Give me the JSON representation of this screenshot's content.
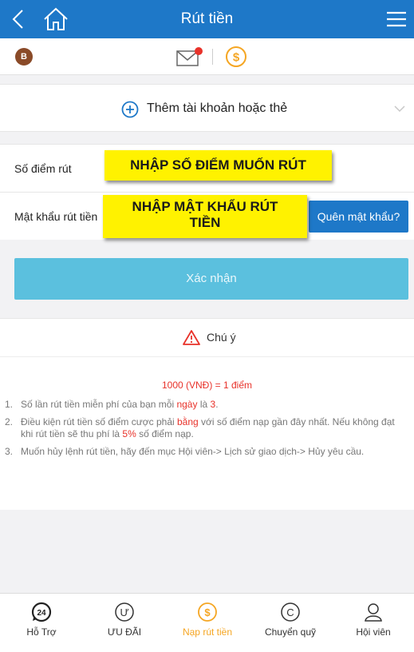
{
  "header": {
    "title": "Rút tiền"
  },
  "user": {
    "avatar_letter": "B"
  },
  "add_account": {
    "label": "Thêm tài khoản hoặc thẻ"
  },
  "form": {
    "points_label": "Số điểm rút",
    "password_label": "Mật khẩu rút tiền",
    "forgot_label": "Quên mật khẩu?",
    "submit_label": "Xác nhận"
  },
  "callouts": {
    "points_hint": "NHẬP SỐ ĐIỂM MUỐN RÚT",
    "password_hint_line1": "NHẬP MẬT KHẨU RÚT",
    "password_hint_line2": "TIỀN"
  },
  "notice": {
    "title": "Chú ý",
    "rate": "1000 (VNĐ) = 1 điểm",
    "rules": [
      {
        "num": "1.",
        "a": "Số lần rút tiền miễn phí của bạn mỗi ",
        "b": "ngày",
        "c": " là ",
        "d": "3",
        "e": "."
      },
      {
        "num": "2.",
        "a": "Điều kiện rút tiền số điểm cược phải ",
        "b": "bằng",
        "c": " với số điểm nạp gần đây nhất. Nếu không đạt khi rút tiền sẽ thu phí là ",
        "d": "5%",
        "e": " số điểm nạp."
      },
      {
        "num": "3.",
        "text": "Muốn hủy lệnh rút tiền, hãy đến mục Hội viên-> Lịch sử giao dịch-> Hủy yêu cầu."
      }
    ]
  },
  "bottom_nav": {
    "items": [
      {
        "label": "Hỗ Trợ",
        "icon": "support-24-icon"
      },
      {
        "label": "ƯU ĐÃI",
        "icon": "promo-icon"
      },
      {
        "label": "Nạp rút tiền",
        "icon": "dollar-coin-icon"
      },
      {
        "label": "Chuyển quỹ",
        "icon": "transfer-icon"
      },
      {
        "label": "Hội viên",
        "icon": "member-icon"
      }
    ],
    "active_index": 2
  },
  "colors": {
    "primary": "#1e78c8",
    "submit": "#5bc0de",
    "accent": "#f5a623",
    "warning": "#e8322a",
    "callout": "#fff200"
  }
}
